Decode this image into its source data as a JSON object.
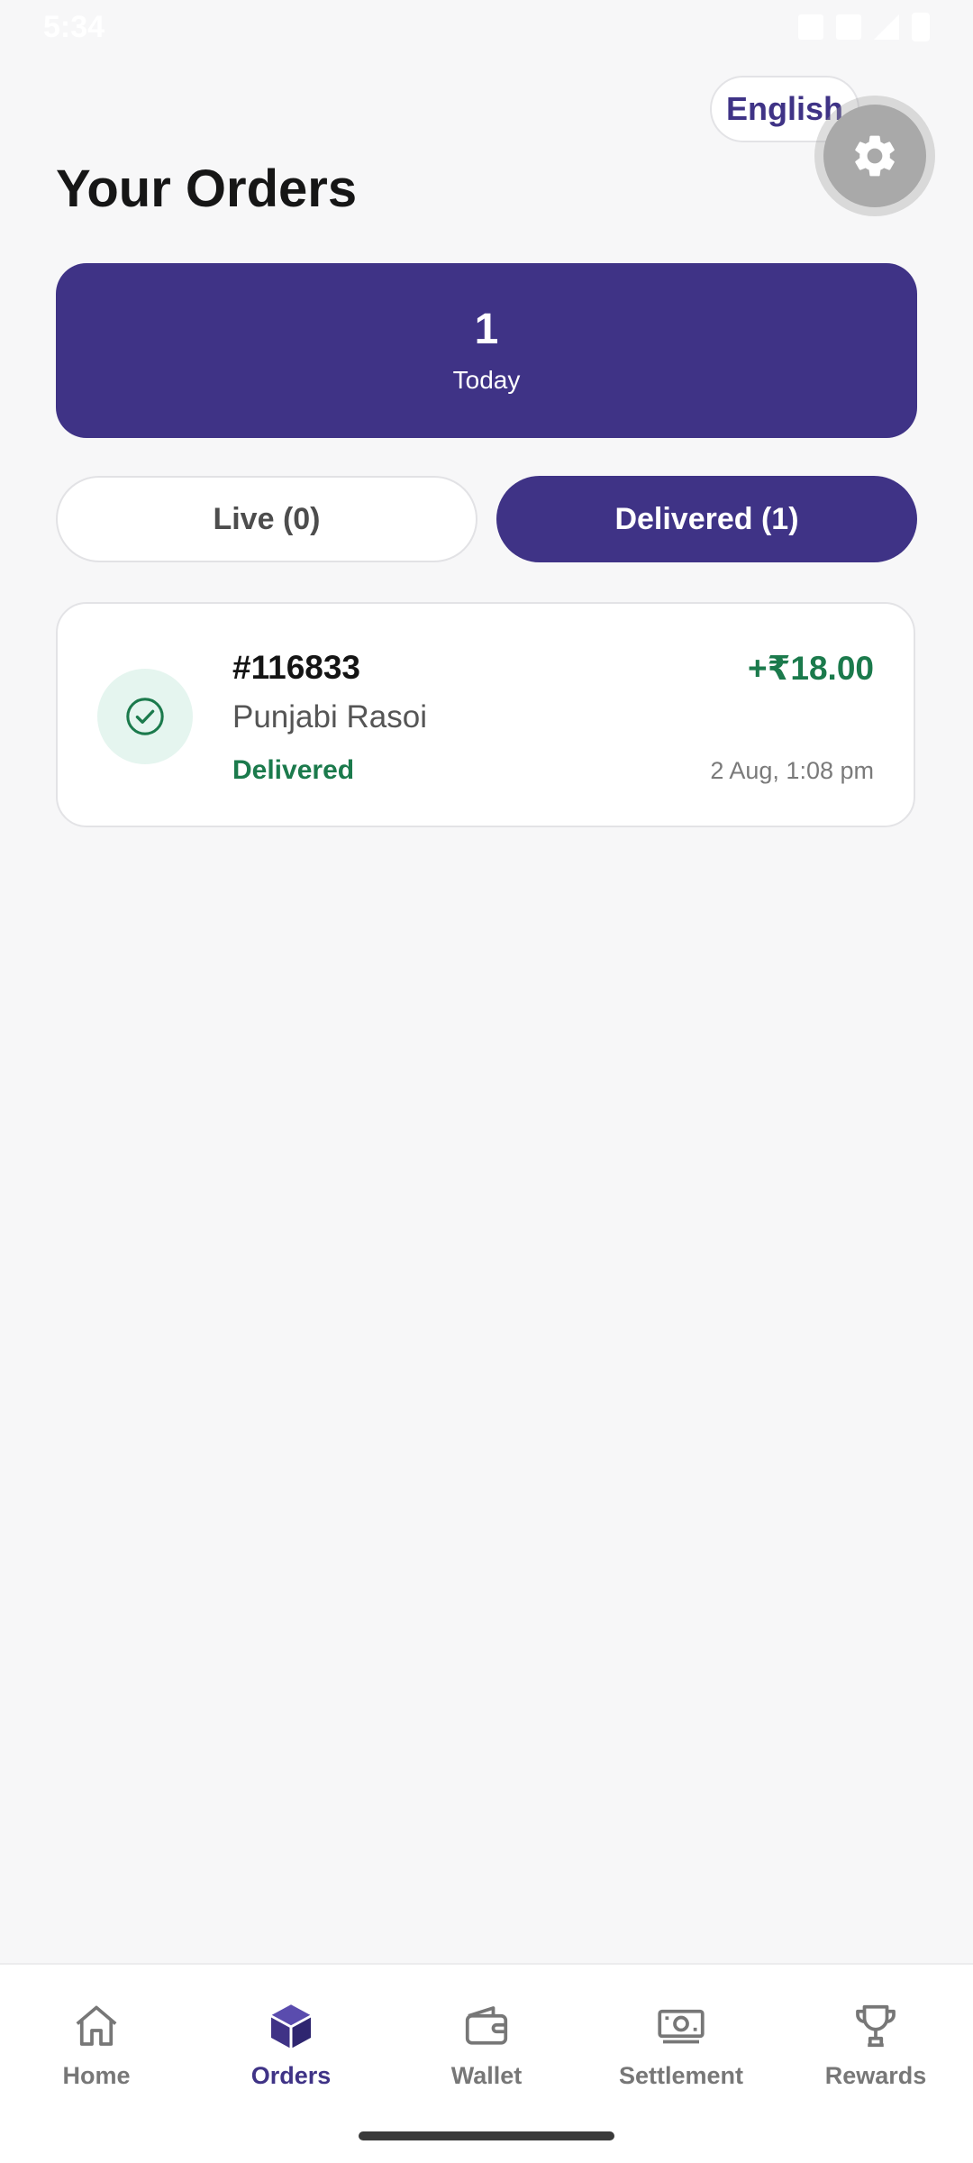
{
  "status_bar": {
    "time": "5:34"
  },
  "header": {
    "language": "English",
    "title": "Your Orders"
  },
  "summary": {
    "count": "1",
    "label": "Today"
  },
  "tabs": [
    {
      "label": "Live (0)",
      "active": false
    },
    {
      "label": "Delivered (1)",
      "active": true
    }
  ],
  "orders": [
    {
      "id": "#116833",
      "amount": "+₹18.00",
      "restaurant": "Punjabi Rasoi",
      "status": "Delivered",
      "time": "2 Aug, 1:08 pm",
      "icon": "check-circle-icon"
    }
  ],
  "bottom_nav": [
    {
      "label": "Home",
      "icon": "home-icon",
      "active": false
    },
    {
      "label": "Orders",
      "icon": "box-icon",
      "active": true
    },
    {
      "label": "Wallet",
      "icon": "wallet-icon",
      "active": false
    },
    {
      "label": "Settlement",
      "icon": "cash-icon",
      "active": false
    },
    {
      "label": "Rewards",
      "icon": "trophy-icon",
      "active": false
    }
  ],
  "colors": {
    "primary": "#3f3386",
    "success": "#1b7a4c",
    "success_bg": "#e5f5ef",
    "background": "#f7f7f8"
  }
}
